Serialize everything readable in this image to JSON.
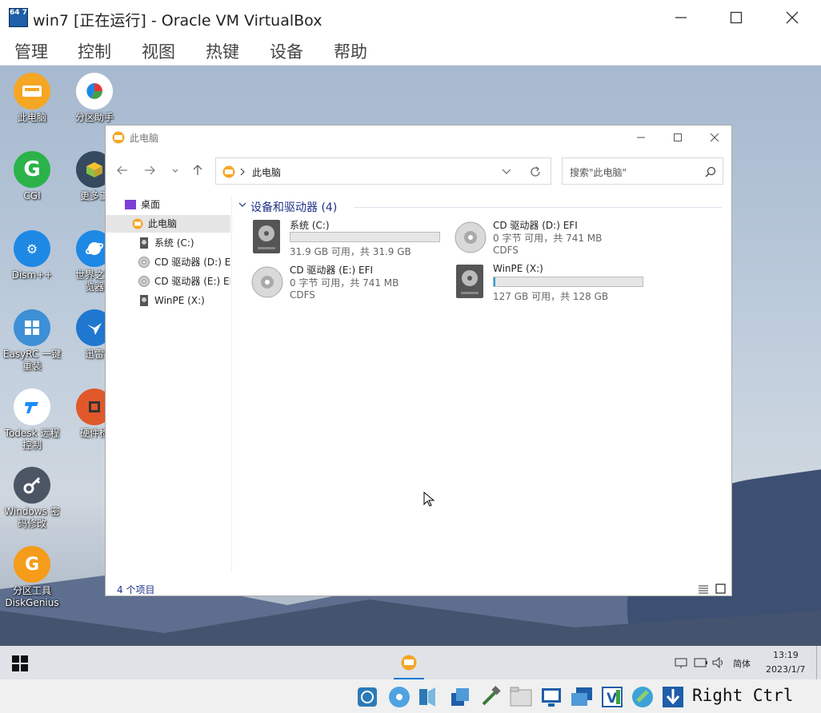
{
  "window": {
    "logo_text": "64 7",
    "title": "win7 [正在运行] - Oracle VM VirtualBox"
  },
  "menu": [
    "管理",
    "控制",
    "视图",
    "热键",
    "设备",
    "帮助"
  ],
  "desktop_icons": [
    {
      "label": "此电脑",
      "icon": "this-pc-icon",
      "color": "#f5a623"
    },
    {
      "label": "分区助手",
      "icon": "partition-assistant-icon",
      "color": "#ffffff"
    },
    {
      "label": "CGI",
      "icon": "cgi-icon",
      "color": "#2bb34a"
    },
    {
      "label": "更多工",
      "icon": "more-tools-icon",
      "color": "#354a5f"
    },
    {
      "label": "Dism++",
      "icon": "dism-icon",
      "color": "#1e88e5"
    },
    {
      "label": "世界之窗\n览器",
      "icon": "browser-icon",
      "color": "#1e88e5"
    },
    {
      "label": "EasyRC 一键\n重装",
      "icon": "easyrc-icon",
      "color": "#3d8fd6"
    },
    {
      "label": "迅雷",
      "icon": "xunlei-icon",
      "color": "#1f77d0"
    },
    {
      "label": "Todesk 远程\n控制",
      "icon": "todesk-icon",
      "color": "#ffffff"
    },
    {
      "label": "硬件检",
      "icon": "hardware-check-icon",
      "color": "#e0582a"
    },
    {
      "label": "Windows 密\n码修改",
      "icon": "key-icon",
      "color": "#4b5563"
    },
    {
      "label": "分区工具\nDiskGenius",
      "icon": "diskgenius-icon",
      "color": "#f59c1a"
    }
  ],
  "explorer": {
    "title": "此电脑",
    "address": "此电脑",
    "search_placeholder": "搜索\"此电脑\"",
    "sidebar": [
      "桌面",
      "此电脑",
      "系统 (C:)",
      "CD 驱动器 (D:) EF",
      "CD 驱动器 (E:) EF",
      "WinPE (X:)"
    ],
    "group_title": "设备和驱动器 (4)",
    "drives": [
      {
        "name": "系统 (C:)",
        "info": "31.9 GB 可用，共 31.9 GB",
        "used": 0.0,
        "kind": "disk"
      },
      {
        "name": "CD 驱动器 (D:) EFI",
        "info": "0 字节 可用，共 741 MB",
        "fs": "CDFS",
        "kind": "cd"
      },
      {
        "name": "CD 驱动器 (E:) EFI",
        "info": "0 字节 可用，共 741 MB",
        "fs": "CDFS",
        "kind": "cd"
      },
      {
        "name": "WinPE (X:)",
        "info": "127 GB 可用，共 128 GB",
        "used": 0.01,
        "kind": "disk"
      }
    ],
    "status": "4 个项目"
  },
  "taskbar": {
    "ime": "简体",
    "time": "13:19",
    "date": "2023/1/7"
  },
  "statusbar": {
    "host_key": "Right Ctrl"
  }
}
